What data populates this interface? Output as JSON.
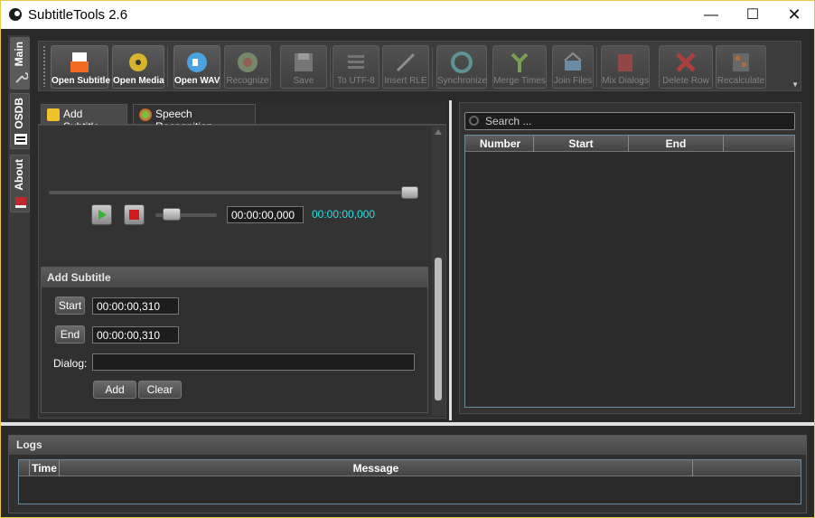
{
  "window": {
    "title": "SubtitleTools 2.6"
  },
  "sidebar": {
    "tabs": [
      {
        "label": "Main"
      },
      {
        "label": "OSDB"
      },
      {
        "label": "About"
      }
    ]
  },
  "toolbar": {
    "buttons": [
      {
        "label": "Open Subtitle",
        "enabled": true,
        "icon": "open-subtitle-icon"
      },
      {
        "label": "Open Media",
        "enabled": true,
        "icon": "film-reel-icon"
      },
      {
        "label": "Open WAV",
        "enabled": true,
        "icon": "speaker-icon"
      },
      {
        "label": "Recognize",
        "enabled": false,
        "icon": "recognize-icon"
      },
      {
        "label": "Save",
        "enabled": false,
        "icon": "floppy-icon"
      },
      {
        "label": "To UTF-8",
        "enabled": false,
        "icon": "encoding-icon"
      },
      {
        "label": "Insert RLE",
        "enabled": false,
        "icon": "pen-icon"
      },
      {
        "label": "Synchronize",
        "enabled": false,
        "icon": "sync-icon"
      },
      {
        "label": "Merge Times",
        "enabled": false,
        "icon": "merge-icon"
      },
      {
        "label": "Join Files",
        "enabled": false,
        "icon": "basket-icon"
      },
      {
        "label": "Mix Dialogs",
        "enabled": false,
        "icon": "books-icon"
      },
      {
        "label": "Delete Row",
        "enabled": false,
        "icon": "delete-x-icon"
      },
      {
        "label": "Recalculate",
        "enabled": false,
        "icon": "calculator-icon"
      }
    ]
  },
  "tabs": [
    {
      "label": "Add Subtitle"
    },
    {
      "label": "Speech Recognition"
    }
  ],
  "player": {
    "current_time": "00:00:00,000",
    "position_time": "00:00:00,000"
  },
  "add_subtitle": {
    "title": "Add Subtitle",
    "start_label": "Start",
    "start_value": "00:00:00,310",
    "end_label": "End",
    "end_value": "00:00:00,310",
    "dialog_label": "Dialog:",
    "dialog_value": "",
    "add_label": "Add",
    "clear_label": "Clear"
  },
  "subtitle_list": {
    "search_placeholder": "Search ...",
    "columns": [
      "Number",
      "Start",
      "End"
    ]
  },
  "logs": {
    "title": "Logs",
    "columns": [
      "Time",
      "Message"
    ]
  },
  "colors": {
    "accent_time": "#22e3e3",
    "window_border": "#e8c84a"
  }
}
